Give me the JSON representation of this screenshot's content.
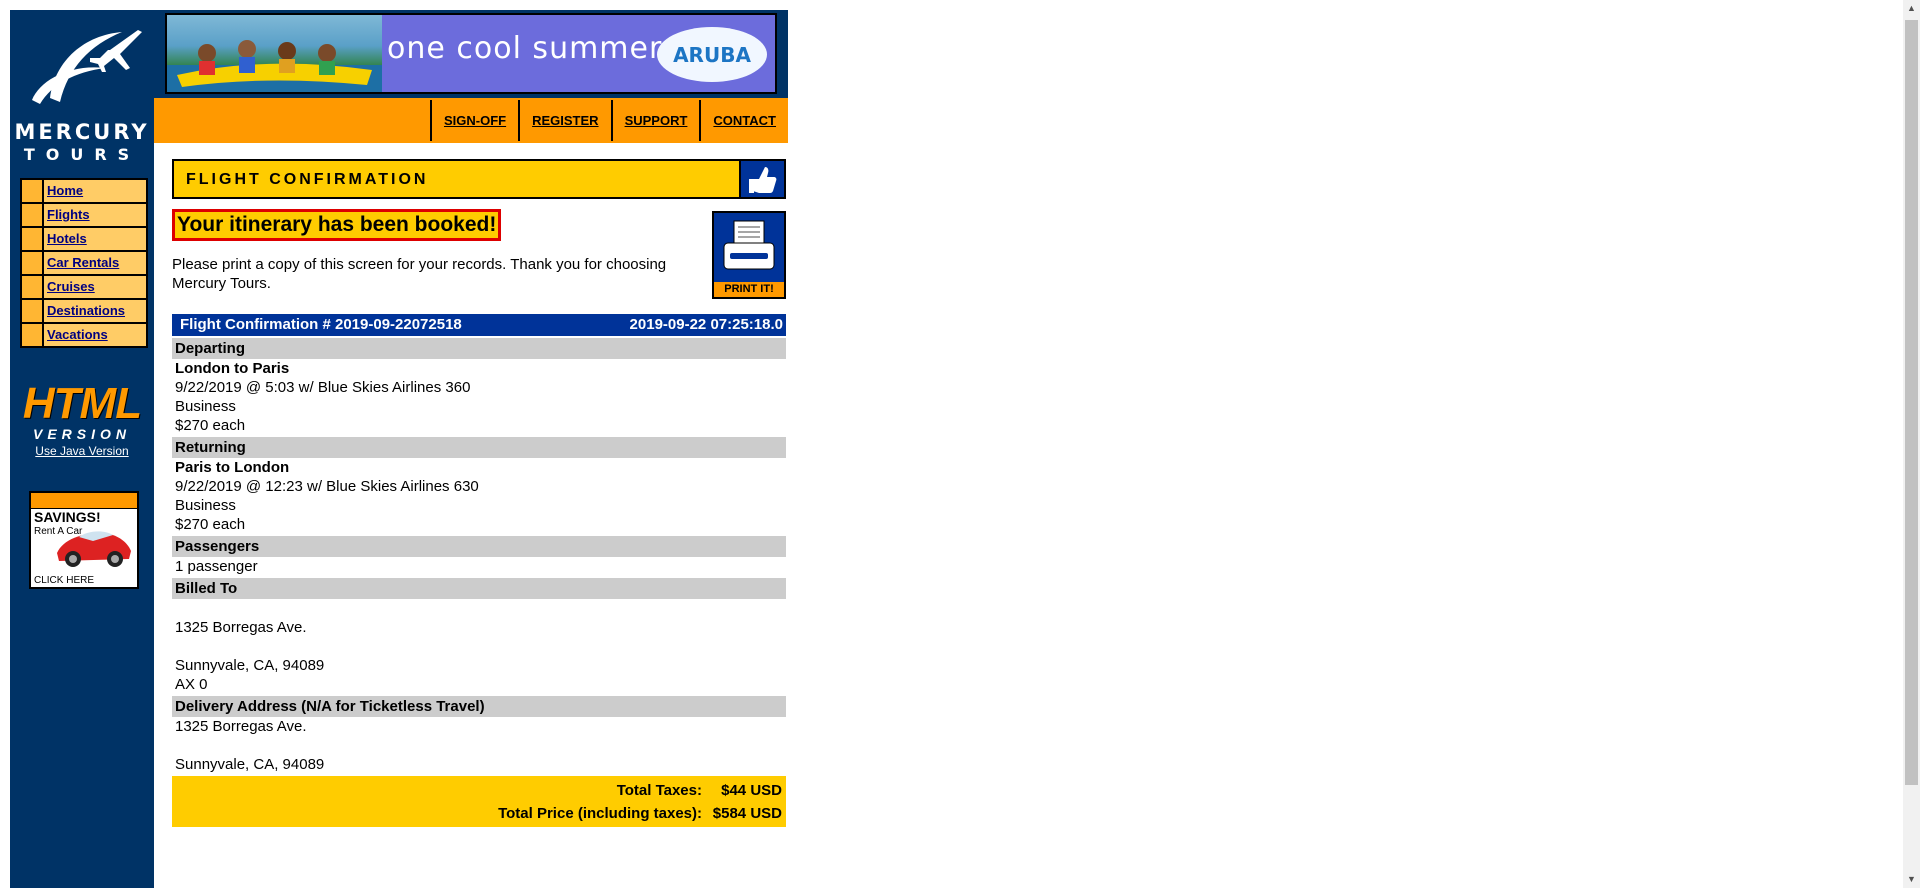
{
  "brand": {
    "line1": "MERCURY",
    "line2": "TOURS"
  },
  "sidebar": {
    "nav": [
      {
        "label": "Home"
      },
      {
        "label": "Flights"
      },
      {
        "label": "Hotels"
      },
      {
        "label": "Car Rentals"
      },
      {
        "label": "Cruises"
      },
      {
        "label": "Destinations"
      },
      {
        "label": "Vacations"
      }
    ],
    "html_badge": {
      "word": "HTML",
      "version": "VERSION"
    },
    "java_link": "Use Java Version",
    "ad": {
      "title": "SAVINGS!",
      "subtitle": "Rent A Car",
      "cta": "CLICK HERE"
    }
  },
  "banner": {
    "text": "one cool summer",
    "logo": "ARUBA"
  },
  "topnav": [
    {
      "label": "SIGN-OFF"
    },
    {
      "label": "REGISTER"
    },
    {
      "label": "SUPPORT"
    },
    {
      "label": "CONTACT"
    }
  ],
  "main": {
    "title": "FLIGHT CONFIRMATION",
    "booked_msg": "Your itinerary has been booked!",
    "print_msg": "Please print a copy of this screen for your records. Thank you for choosing Mercury Tours.",
    "print_label": "PRINT IT!",
    "confirmation": {
      "number": "Flight Confirmation # 2019-09-22072518",
      "timestamp": "2019-09-22 07:25:18.0"
    },
    "departing": {
      "heading": "Departing",
      "route": "London to Paris",
      "details": "9/22/2019 @ 5:03 w/ Blue Skies Airlines 360",
      "class": "Business",
      "price": "$270 each"
    },
    "returning": {
      "heading": "Returning",
      "route": "Paris to London",
      "details": "9/22/2019 @ 12:23 w/ Blue Skies Airlines 630",
      "class": "Business",
      "price": "$270 each"
    },
    "passengers": {
      "heading": "Passengers",
      "count": "1 passenger"
    },
    "billed_to": {
      "heading": "Billed To",
      "address": "1325 Borregas Ave.",
      "city": "Sunnyvale, CA, 94089",
      "card": "AX 0"
    },
    "delivery": {
      "heading": "Delivery Address (N/A for Ticketless Travel)",
      "address": "1325 Borregas Ave.",
      "city": "Sunnyvale, CA, 94089"
    },
    "totals": {
      "taxes_label": "Total Taxes:",
      "taxes_value": "$44 USD",
      "price_label": "Total Price (including taxes):",
      "price_value": "$584 USD"
    }
  },
  "colors": {
    "navy": "#003366",
    "orange": "#ff9900",
    "yellow": "#ffcc00",
    "table_blue": "#003399",
    "section_grey": "#cccccc"
  }
}
